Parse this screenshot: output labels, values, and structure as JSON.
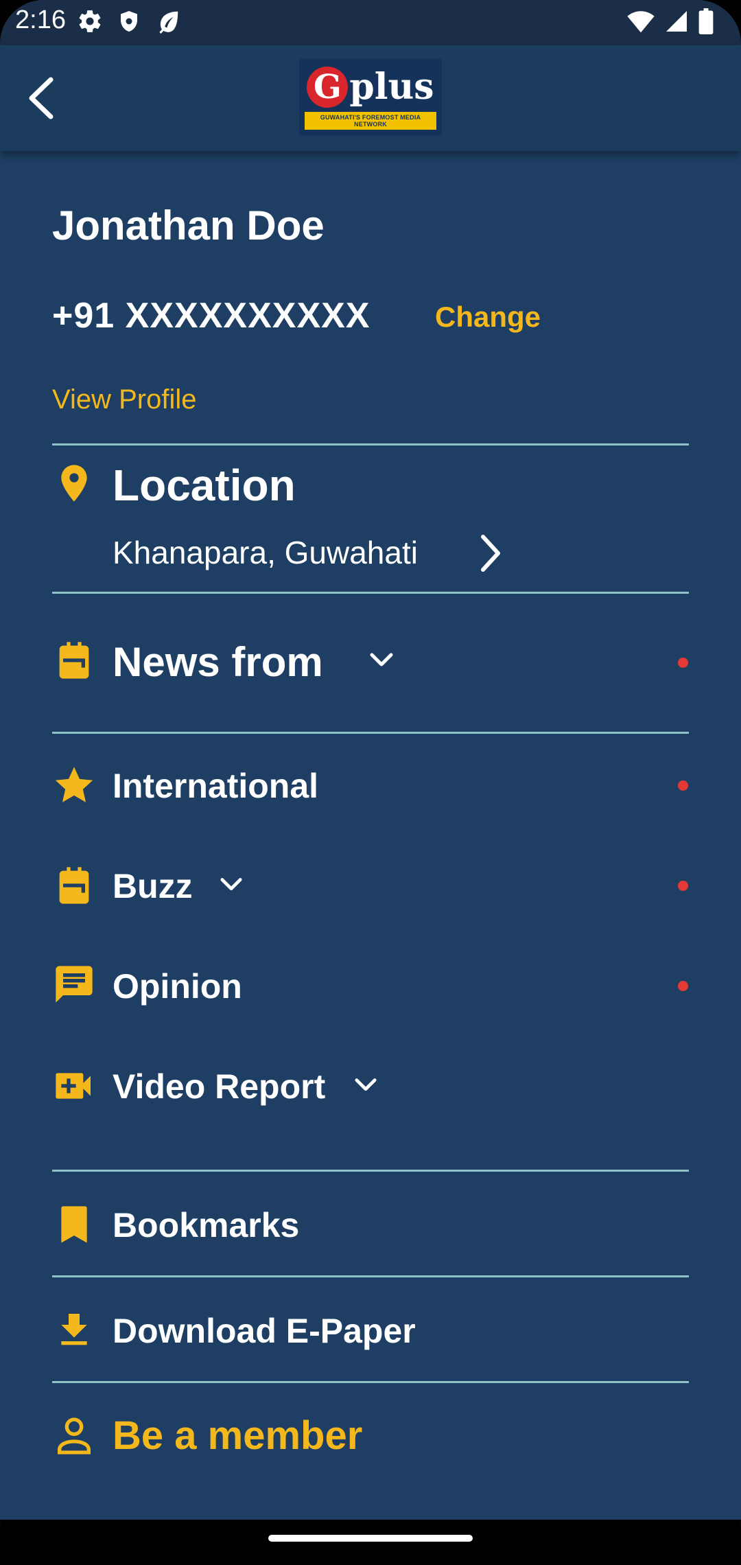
{
  "status": {
    "time": "2:16"
  },
  "header": {
    "logo_text": "plus",
    "logo_letter": "G",
    "logo_tagline": "GUWAHATI'S FOREMOST MEDIA NETWORK"
  },
  "profile": {
    "name": "Jonathan Doe",
    "phone": "+91 XXXXXXXXXX",
    "change_label": "Change",
    "view_profile_label": "View Profile"
  },
  "location": {
    "title": "Location",
    "value": "Khanapara, Guwahati"
  },
  "menu": {
    "news_from": "News from",
    "international": "International",
    "buzz": "Buzz",
    "opinion": "Opinion",
    "video_report": "Video Report",
    "bookmarks": "Bookmarks",
    "download_epaper": "Download E-Paper",
    "be_member": "Be a member"
  },
  "colors": {
    "background": "#1e3f63",
    "accent": "#f4b81c",
    "dot": "#e53935",
    "divider": "#8fc3c8"
  }
}
